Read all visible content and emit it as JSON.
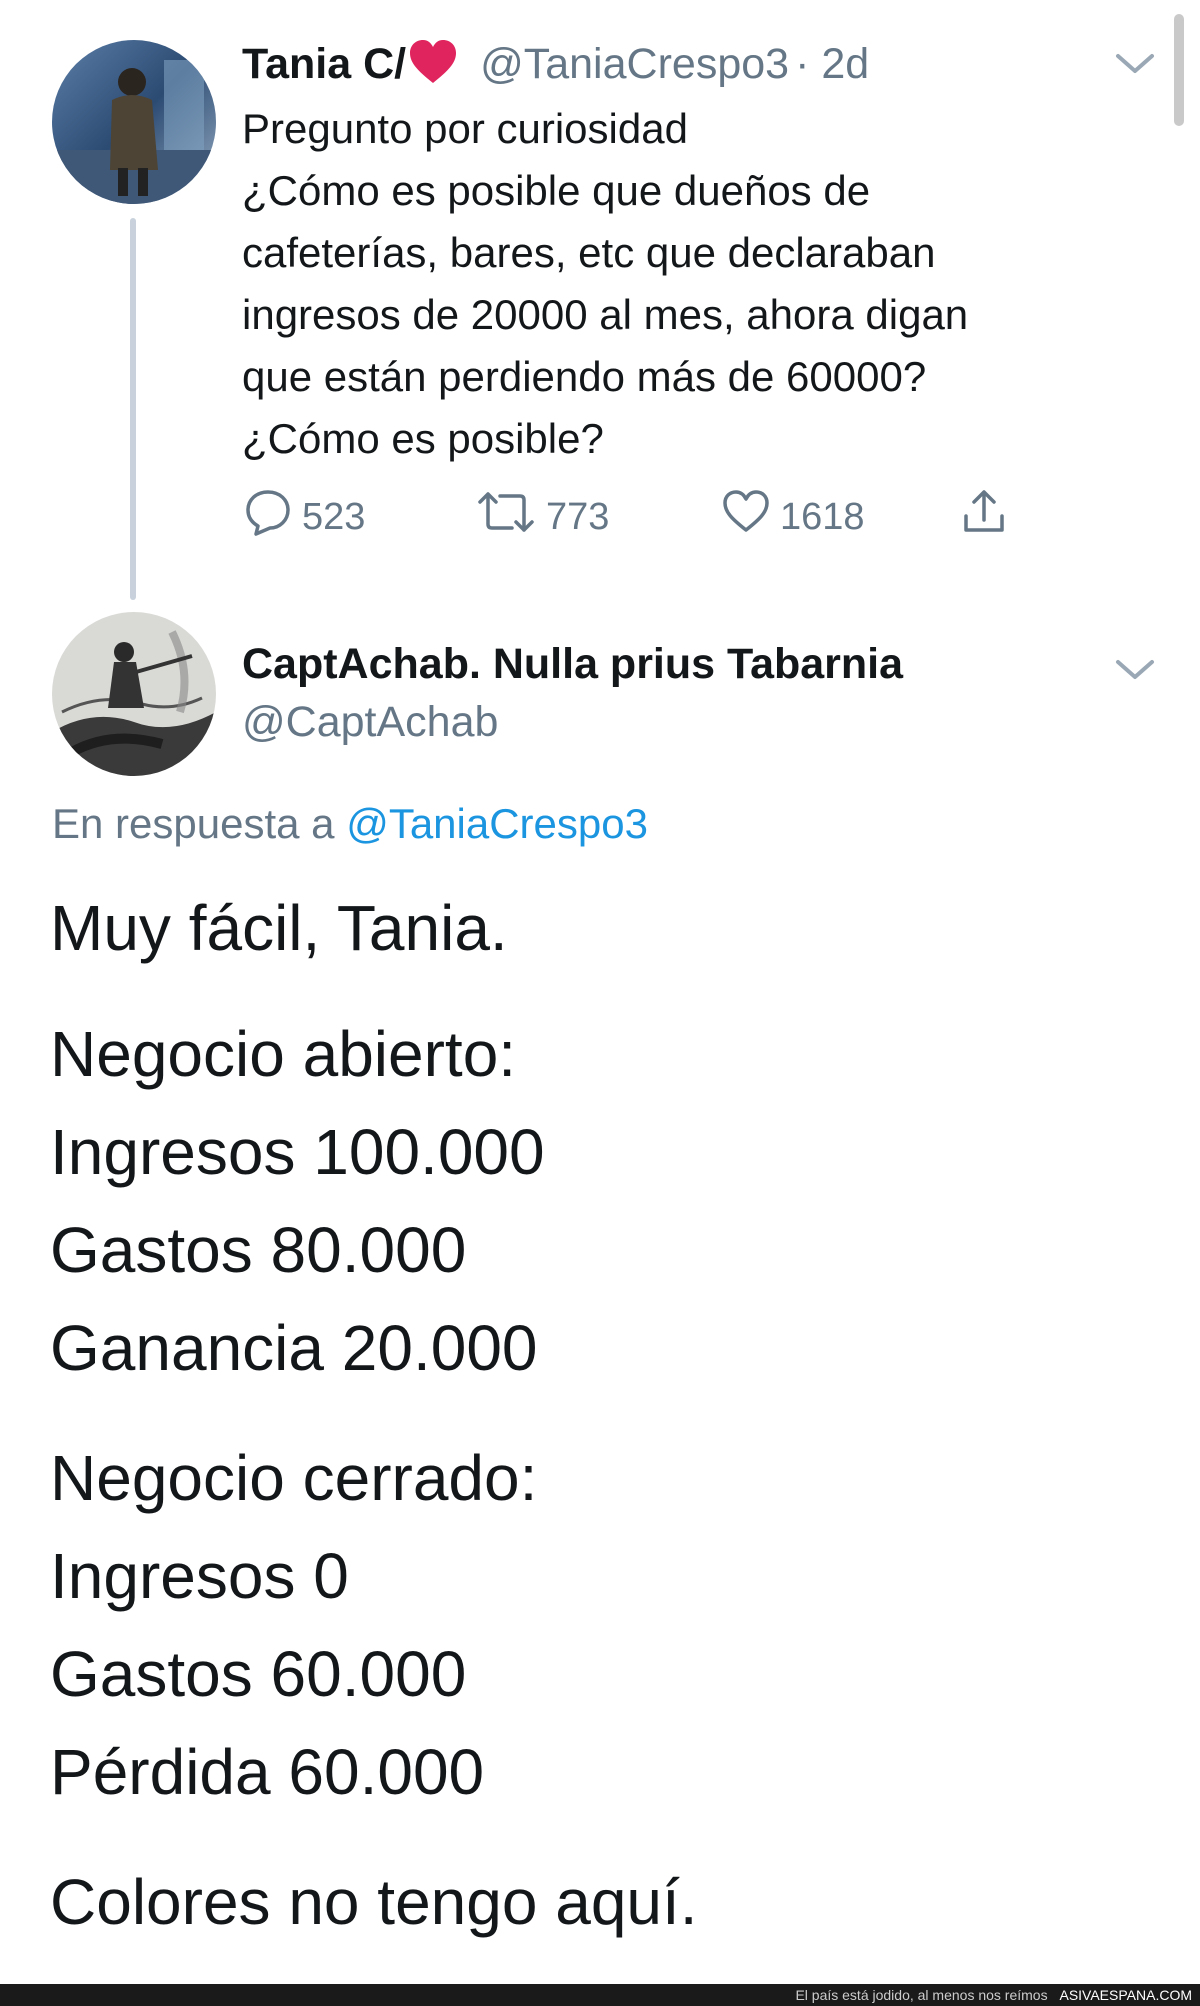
{
  "tweet": {
    "author_name": "Tania C/",
    "author_handle": "@TaniaCrespo3",
    "timestamp": "· 2d",
    "lines": [
      "Pregunto por curiosidad",
      "¿Cómo es posible que dueños de",
      "cafeterías, bares, etc que declaraban",
      "ingresos de 20000 al mes, ahora digan",
      "que están perdiendo más de 60000?",
      "¿Cómo es posible?"
    ],
    "replies": "523",
    "retweets": "773",
    "likes": "1618"
  },
  "reply": {
    "author_name": "CaptAchab. Nulla prius Tabarnia",
    "author_handle": "@CaptAchab",
    "reply_prefix": "En respuesta a",
    "reply_mention": "@TaniaCrespo3",
    "lines": [
      "Muy fácil, Tania.",
      "Negocio abierto:",
      "Ingresos 100.000",
      "Gastos 80.000",
      "Ganancia 20.000",
      "Negocio cerrado:",
      "Ingresos 0",
      "Gastos 60.000",
      "Pérdida 60.000",
      "Colores no tengo aquí."
    ]
  },
  "footer": {
    "caption": "El país está jodido, al menos nos reímos",
    "brand": "ASIVAESPANA.COM"
  },
  "colors": {
    "accent": "#1b95e0",
    "muted": "#657786",
    "heart": "#e0245e"
  },
  "icons": [
    "reply-icon",
    "retweet-icon",
    "like-icon",
    "share-icon",
    "chevron-down-icon",
    "heart-emoji-icon"
  ]
}
